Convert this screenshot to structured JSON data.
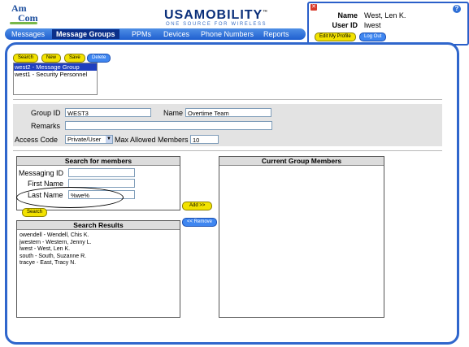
{
  "logo": {
    "line1": "Am",
    "line2": "Com"
  },
  "brand": {
    "usa": "USA",
    "mobility": "MOBILITY",
    "trademark": "™",
    "tagline": "ONE SOURCE FOR WIRELESS"
  },
  "nav": [
    "Messages",
    "Message Groups",
    "PPMs",
    "Devices",
    "Phone Numbers",
    "Reports"
  ],
  "nav_active": "Message Groups",
  "user": {
    "name_label": "Name",
    "name_value": "West, Len K.",
    "userid_label": "User ID",
    "userid_value": "lwest",
    "edit_profile": "Edit My Profile",
    "logout": "Log Out"
  },
  "toolbar": {
    "search": "Search",
    "new": "New",
    "save": "Save",
    "delete": "Delete"
  },
  "groups": [
    "west2 - Message Group",
    "west1 - Security Personnel"
  ],
  "selected_group_index": 0,
  "form": {
    "group_id_label": "Group ID",
    "group_id_value": "WEST3",
    "name_label": "Name",
    "name_value": "Overtime Team",
    "remarks_label": "Remarks",
    "remarks_value": "",
    "access_code_label": "Access Code",
    "access_code_value": "Private/User",
    "max_members_label": "Max Allowed Members",
    "max_members_value": "10"
  },
  "search_members": {
    "title": "Search for members",
    "messaging_id_label": "Messaging ID",
    "messaging_id_value": "",
    "first_name_label": "First Name",
    "first_name_value": "",
    "last_name_label": "Last Name",
    "last_name_value": "%we%",
    "search_button": "Search"
  },
  "search_results": {
    "title": "Search Results",
    "items": [
      "owendell - Wendell, Chis K.",
      "jwestern - Western, Jenny L.",
      "lwest - West, Len K.",
      "south - South, Suzanne R.",
      "tracye - East, Tracy N."
    ]
  },
  "actions": {
    "add": "Add >>",
    "remove": "<< Remove"
  },
  "current_members": {
    "title": "Current Group Members",
    "items": []
  },
  "colors": {
    "nav_blue": "#1f5fcf",
    "accent_yellow": "#f2e200",
    "frame_blue": "#2f66cc",
    "selection": "#1f3fbf"
  },
  "icons": {
    "close": "close-icon",
    "help": "help-icon",
    "select_arrow": "chevron-down-icon"
  }
}
